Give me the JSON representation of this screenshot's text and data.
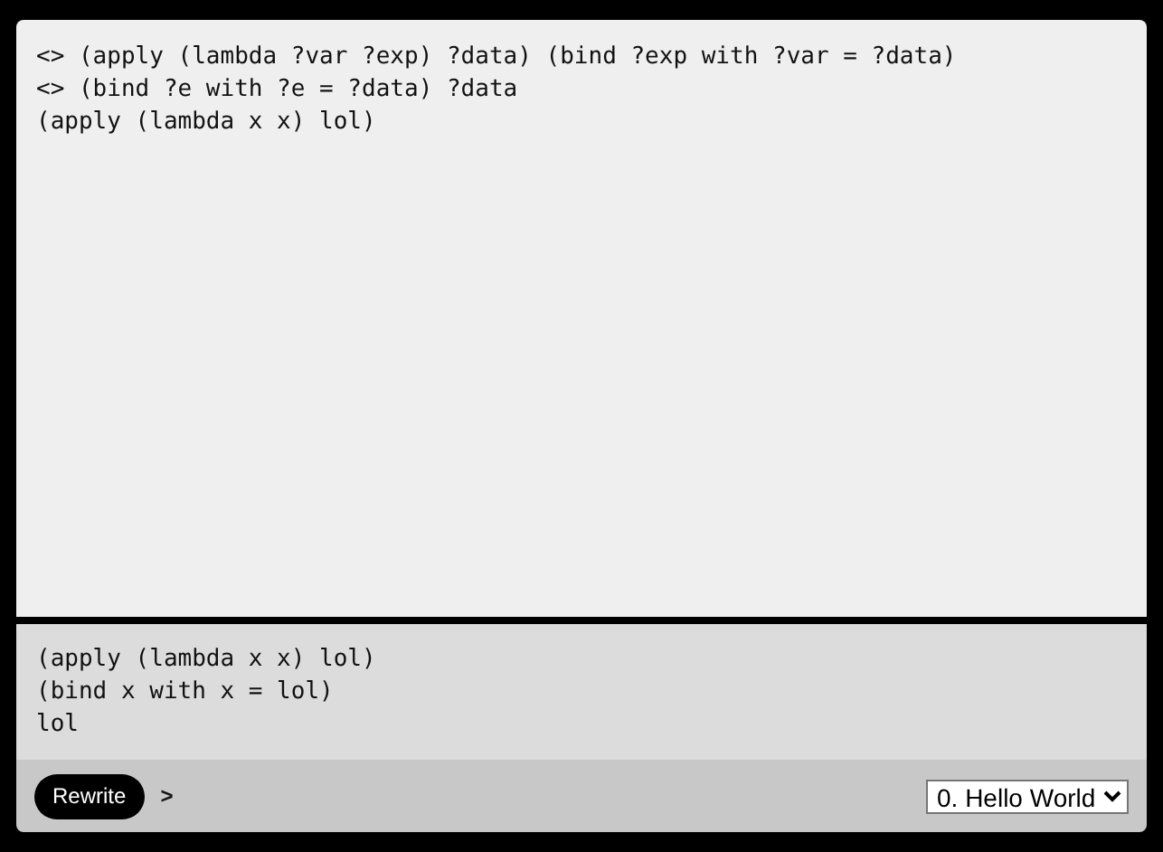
{
  "editor": {
    "lines": [
      "<> (apply (lambda ?var ?exp) ?data) (bind ?exp with ?var = ?data)",
      "<> (bind ?e with ?e = ?data) ?data",
      "(apply (lambda x x) lol)"
    ]
  },
  "output": {
    "lines": [
      "(apply (lambda x x) lol)",
      "(bind x with x = lol)",
      "lol"
    ]
  },
  "footer": {
    "button": "Rewrite",
    "prompt": ">",
    "select": {
      "value": "0. Hello World"
    }
  }
}
